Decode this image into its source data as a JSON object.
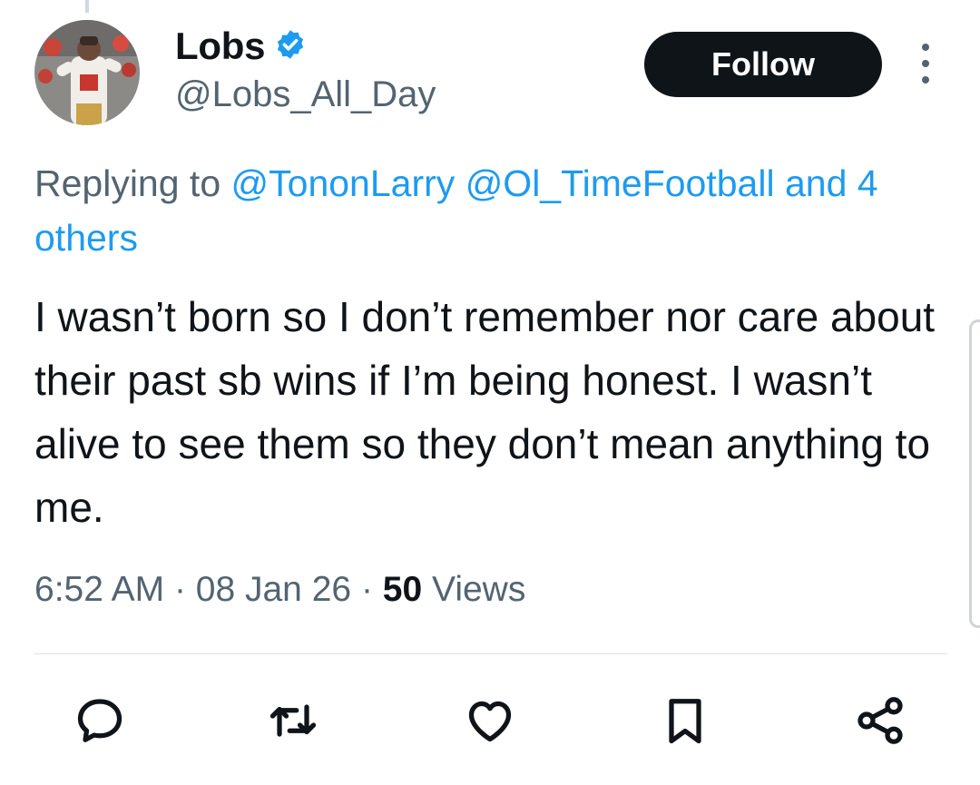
{
  "tweet": {
    "author": {
      "display_name": "Lobs",
      "handle": "@Lobs_All_Day",
      "verified": true,
      "verified_badge_color": "#1d9bf0"
    },
    "follow_label": "Follow",
    "replying_prefix": "Replying to",
    "replying_mentions": [
      "@TononLarry",
      "@Ol_TimeFootball"
    ],
    "replying_joiner": "and",
    "replying_others": "4 others",
    "text": "I wasn’t born so I don’t remember nor care about their past sb wins if I’m being honest. I wasn’t alive to see them so they don’t mean anything to me.",
    "time": "6:52 AM",
    "date": "08 Jan 26",
    "views_count": "50",
    "views_label": "Views",
    "separator": "·"
  },
  "actions": [
    "reply-icon",
    "retweet-icon",
    "like-icon",
    "bookmark-icon",
    "share-icon"
  ],
  "colors": {
    "link": "#1d9bf0",
    "secondary_text": "#536471",
    "primary_text": "#0f1419",
    "button_bg": "#0f1419"
  }
}
